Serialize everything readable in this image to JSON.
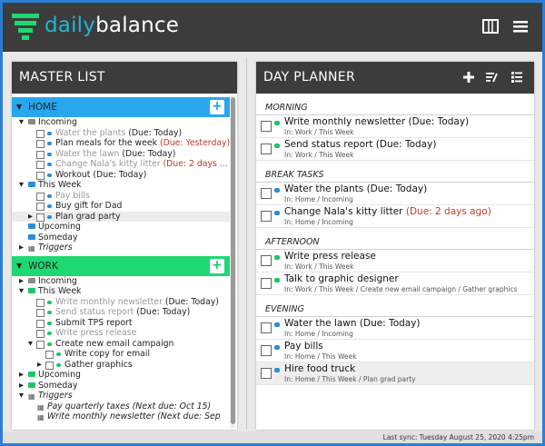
{
  "brand": {
    "part1": "daily",
    "part2": "balance",
    "logo": "stacked-bars-logo"
  },
  "topbar": {
    "icons": [
      "columns-icon",
      "hamburger-menu-icon"
    ]
  },
  "master_list": {
    "title": "MASTER LIST",
    "home": {
      "label": "HOME",
      "rows": [
        {
          "text": "Incoming"
        },
        {
          "text": "Water the plants",
          "due": "(Due: Today)"
        },
        {
          "text": "Plan meals for the week",
          "due": "(Due: Yesterday)"
        },
        {
          "text": "Water the lawn",
          "due": "(Due: Today)"
        },
        {
          "text": "Change Nala's kitty litter",
          "due": "(Due: 2 days ..."
        },
        {
          "text": "Workout",
          "due": "(Due: Today)"
        },
        {
          "text": "This Week"
        },
        {
          "text": "Pay bills"
        },
        {
          "text": "Buy gift for Dad"
        },
        {
          "text": "Plan grad party"
        },
        {
          "text": "Upcoming"
        },
        {
          "text": "Someday"
        },
        {
          "text": "Triggers"
        }
      ]
    },
    "work": {
      "label": "WORK",
      "rows": [
        {
          "text": "Incoming"
        },
        {
          "text": "This Week"
        },
        {
          "text": "Write monthly newsletter",
          "due": "(Due: Today)"
        },
        {
          "text": "Send status report",
          "due": "(Due: Today)"
        },
        {
          "text": "Submit TPS report"
        },
        {
          "text": "Write press release"
        },
        {
          "text": "Create new email campaign"
        },
        {
          "text": "Write copy for email"
        },
        {
          "text": "Gather graphics"
        },
        {
          "text": "Upcoming"
        },
        {
          "text": "Someday"
        },
        {
          "text": "Triggers"
        },
        {
          "text": "Pay quarterly taxes (Next due: Oct 15)"
        },
        {
          "text": "Write monthly newsletter (Next due: Sep"
        }
      ]
    }
  },
  "day_planner": {
    "title": "DAY PLANNER",
    "sections": [
      {
        "label": "MORNING",
        "items": [
          {
            "title": "Write monthly newsletter",
            "due": "(Due: Today)",
            "path": "In: Work / This Week"
          },
          {
            "title": "Send status report",
            "due": "(Due: Today)",
            "path": "In: Work / This Week"
          }
        ]
      },
      {
        "label": "BREAK TASKS",
        "items": [
          {
            "title": "Water the plants",
            "due": "(Due: Today)",
            "path": "In: Home / Incoming"
          },
          {
            "title": "Change Nala's kitty litter",
            "due": "(Due: 2 days ago)",
            "path": "In: Home / Incoming"
          }
        ]
      },
      {
        "label": "AFTERNOON",
        "items": [
          {
            "title": "Write press release",
            "due": "",
            "path": "In: Work / This Week"
          },
          {
            "title": "Talk to graphic designer",
            "due": "",
            "path": "In: Work / This Week / Create new email campaign / Gather graphics"
          }
        ]
      },
      {
        "label": "EVENING",
        "items": [
          {
            "title": "Water the lawn",
            "due": "(Due: Today)",
            "path": "In: Home / Incoming"
          },
          {
            "title": "Pay bills",
            "due": "",
            "path": "In: Home / This Week"
          },
          {
            "title": "Hire food truck",
            "due": "",
            "path": "In: Home / This Week / Plan grad party"
          }
        ]
      }
    ]
  },
  "status": {
    "last_sync": "Last sync: Tuesday August 25, 2020 4:25pm"
  },
  "colors": {
    "home": "#28a7ee",
    "work": "#1ed872",
    "header": "#3c3c3c",
    "overdue": "#c0392b"
  }
}
